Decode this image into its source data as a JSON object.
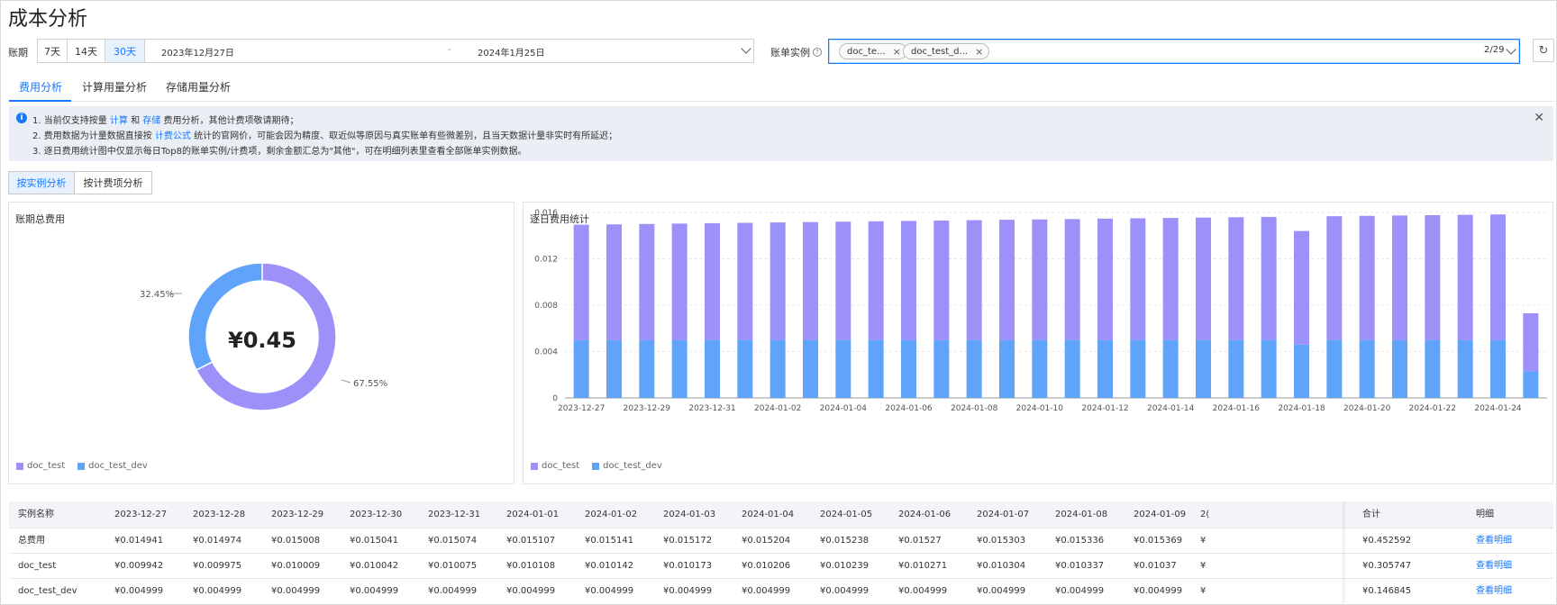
{
  "page": {
    "title": "成本分析"
  },
  "filters": {
    "period_label": "账期",
    "period_options": [
      "7天",
      "14天",
      "30天"
    ],
    "period_selected": "30天",
    "date_start": "2023年12月27日",
    "date_separator": "-",
    "date_end": "2024年1月25日",
    "instance_label": "账单实例",
    "instance_tags": [
      "doc_te...",
      "doc_test_d..."
    ],
    "instance_count": "2/29"
  },
  "tabs": [
    "费用分析",
    "计算用量分析",
    "存储用量分析"
  ],
  "notice": {
    "line1": [
      "1. 当前仅支持按量 ",
      "计算",
      " 和 ",
      "存储",
      " 费用分析，其他计费项敬请期待；"
    ],
    "line2": [
      "2. 费用数据为计量数据直接按 ",
      "计费公式",
      " 统计的官网价，可能会因为精度、取近似等原因与真实账单有些微差别，且当天数据计量非实时有所延迟；"
    ],
    "line3": "3. 逐日费用统计图中仅显示每日Top8的账单实例/计费项，剩余金额汇总为\"其他\"，可在明细列表里查看全部账单实例数据。"
  },
  "subtabs": [
    "按实例分析",
    "按计费项分析"
  ],
  "colors": {
    "doc_test": "#9b91f9",
    "doc_test_dev": "#5fa3fb",
    "accent": "#1677ff"
  },
  "donut": {
    "title": "账期总费用",
    "total": "¥0.45",
    "slices": [
      {
        "name": "doc_test",
        "percent": 67.55,
        "label": "67.55%"
      },
      {
        "name": "doc_test_dev",
        "percent": 32.45,
        "label": "32.45%"
      }
    ],
    "legend": [
      "doc_test",
      "doc_test_dev"
    ]
  },
  "chart_data": {
    "type": "bar",
    "stacked": true,
    "title": "逐日费用统计",
    "categories": [
      "2023-12-27",
      "2023-12-28",
      "2023-12-29",
      "2023-12-30",
      "2023-12-31",
      "2024-01-01",
      "2024-01-02",
      "2024-01-03",
      "2024-01-04",
      "2024-01-05",
      "2024-01-06",
      "2024-01-07",
      "2024-01-08",
      "2024-01-09",
      "2024-01-10",
      "2024-01-11",
      "2024-01-12",
      "2024-01-13",
      "2024-01-14",
      "2024-01-15",
      "2024-01-16",
      "2024-01-17",
      "2024-01-18",
      "2024-01-19",
      "2024-01-20",
      "2024-01-21",
      "2024-01-22",
      "2024-01-23",
      "2024-01-24",
      "2024-01-25"
    ],
    "x_tick_labels": [
      "2023-12-27",
      "2023-12-29",
      "2023-12-31",
      "2024-01-02",
      "2024-01-04",
      "2024-01-06",
      "2024-01-08",
      "2024-01-10",
      "2024-01-12",
      "2024-01-14",
      "2024-01-16",
      "2024-01-18",
      "2024-01-20",
      "2024-01-22",
      "2024-01-24"
    ],
    "series": [
      {
        "name": "doc_test_dev",
        "values": [
          0.004999,
          0.004999,
          0.004999,
          0.004999,
          0.004999,
          0.004999,
          0.004999,
          0.004999,
          0.004999,
          0.004999,
          0.004999,
          0.004999,
          0.004999,
          0.004999,
          0.004999,
          0.004999,
          0.004999,
          0.004999,
          0.004999,
          0.004999,
          0.004999,
          0.004999,
          0.0046,
          0.004999,
          0.004999,
          0.004999,
          0.004999,
          0.004999,
          0.004999,
          0.0023
        ]
      },
      {
        "name": "doc_test",
        "values": [
          0.009942,
          0.009975,
          0.010009,
          0.010042,
          0.010075,
          0.010108,
          0.010142,
          0.010173,
          0.010206,
          0.010239,
          0.010271,
          0.010304,
          0.010337,
          0.01037,
          0.0104,
          0.01043,
          0.01047,
          0.0105,
          0.01053,
          0.01056,
          0.01059,
          0.01062,
          0.0098,
          0.01068,
          0.01071,
          0.01074,
          0.01077,
          0.0108,
          0.01083,
          0.005
        ]
      }
    ],
    "ylim": [
      0,
      0.016
    ],
    "y_ticks": [
      "0",
      "0.004",
      "0.008",
      "0.012",
      "0.016"
    ],
    "legend": [
      "doc_test",
      "doc_test_dev"
    ]
  },
  "table": {
    "headers": [
      "实例名称",
      "2023-12-27",
      "2023-12-28",
      "2023-12-29",
      "2023-12-30",
      "2023-12-31",
      "2024-01-01",
      "2024-01-02",
      "2024-01-03",
      "2024-01-04",
      "2024-01-05",
      "2024-01-06",
      "2024-01-07",
      "2024-01-08",
      "2024-01-09",
      "2("
    ],
    "fixed_headers": [
      "合计",
      "明细"
    ],
    "rows": [
      {
        "name": "总费用",
        "values": [
          "¥0.014941",
          "¥0.014974",
          "¥0.015008",
          "¥0.015041",
          "¥0.015074",
          "¥0.015107",
          "¥0.015141",
          "¥0.015172",
          "¥0.015204",
          "¥0.015238",
          "¥0.01527",
          "¥0.015303",
          "¥0.015336",
          "¥0.015369",
          "¥"
        ],
        "total": "¥0.452592",
        "detail": "查看明细"
      },
      {
        "name": "doc_test",
        "values": [
          "¥0.009942",
          "¥0.009975",
          "¥0.010009",
          "¥0.010042",
          "¥0.010075",
          "¥0.010108",
          "¥0.010142",
          "¥0.010173",
          "¥0.010206",
          "¥0.010239",
          "¥0.010271",
          "¥0.010304",
          "¥0.010337",
          "¥0.01037",
          "¥"
        ],
        "total": "¥0.305747",
        "detail": "查看明细"
      },
      {
        "name": "doc_test_dev",
        "values": [
          "¥0.004999",
          "¥0.004999",
          "¥0.004999",
          "¥0.004999",
          "¥0.004999",
          "¥0.004999",
          "¥0.004999",
          "¥0.004999",
          "¥0.004999",
          "¥0.004999",
          "¥0.004999",
          "¥0.004999",
          "¥0.004999",
          "¥0.004999",
          "¥"
        ],
        "total": "¥0.146845",
        "detail": "查看明细"
      }
    ]
  }
}
